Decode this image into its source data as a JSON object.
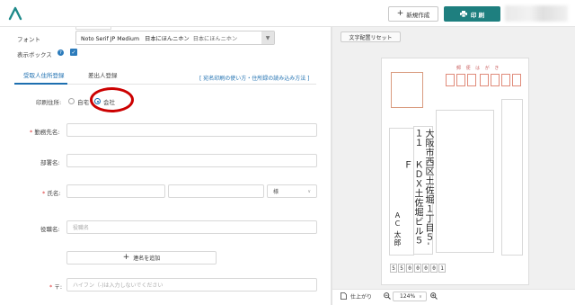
{
  "header": {
    "new_button_label": "新規作成",
    "print_button_label": "印 刷"
  },
  "form": {
    "font_label": "フォント",
    "font_value": "Noto Serif JP Medium　日本にほんニホン",
    "font_preview": "日本にほんニホン",
    "display_box_label": "表示ボックス",
    "display_box_checked": true,
    "tabs": [
      {
        "label": "受取人住所登録",
        "active": true
      },
      {
        "label": "差出人登録",
        "active": false
      }
    ],
    "help_link": "[ 宛名印刷の使い方・住所録の読み込み方法 ]",
    "print_address_label": "印刷住所:",
    "print_address_options": [
      {
        "label": "自宅",
        "checked": false
      },
      {
        "label": "会社",
        "checked": true
      }
    ],
    "company_label": "勤務先名:",
    "department_label": "部署名:",
    "name_label": "氏名:",
    "honorific_value": "様",
    "position_label": "役職名:",
    "position_placeholder": "役職名",
    "add_joint_name": "連名を追加",
    "zip_label": "〒:",
    "zip_placeholder": "ハイフン（-)は入力しないでください",
    "required_mark": "*"
  },
  "preview": {
    "reset_button_label": "文字配置リセット",
    "sender_label": "郵 便 は が き",
    "address_line1": "大阪市西区土佐堀１丁目５‐１１",
    "address_line2": "ＫＤＸ土佐堀ビル５Ｆ",
    "recipient_name": "ＡＣ 太郎",
    "zip_digits": [
      "5",
      "5",
      "0",
      "0",
      "0",
      "0",
      "1"
    ],
    "finish_label": "仕上がり",
    "zoom_value": "124%"
  },
  "colors": {
    "accent": "#1d6fb0",
    "print_button": "#1e7f7f",
    "highlight": "#cc0000",
    "required": "#dd3333"
  }
}
